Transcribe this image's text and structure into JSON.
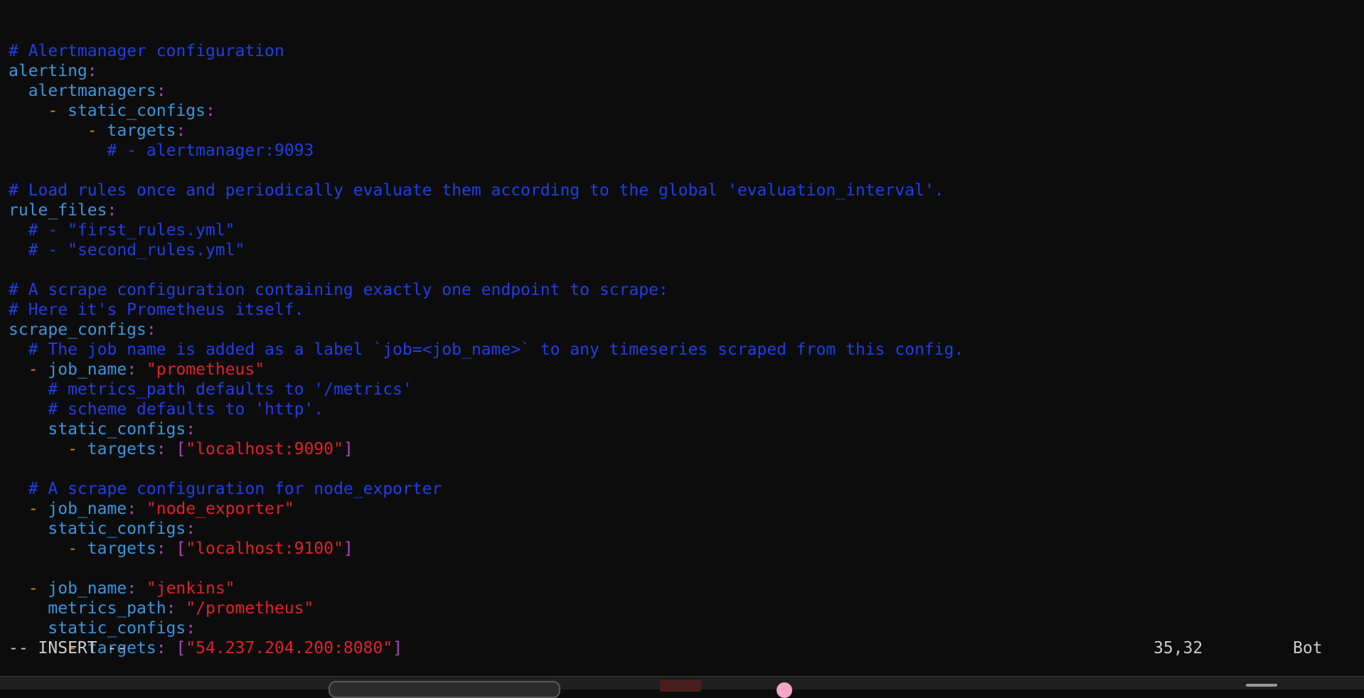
{
  "editor": {
    "lines": [
      {
        "id": "blank-top",
        "segments": []
      },
      {
        "id": "comment-alertmanager",
        "segments": [
          {
            "t": "# Alertmanager configuration",
            "c": "c"
          }
        ]
      },
      {
        "id": "key-alerting",
        "segments": [
          {
            "t": "alerting",
            "c": "k"
          },
          {
            "t": ":",
            "c": "p"
          }
        ]
      },
      {
        "id": "key-alertmanagers",
        "segments": [
          {
            "t": "  "
          },
          {
            "t": "alertmanagers",
            "c": "k"
          },
          {
            "t": ":",
            "c": "p"
          }
        ]
      },
      {
        "id": "key-static-configs-1",
        "segments": [
          {
            "t": "    "
          },
          {
            "t": "- ",
            "c": "d"
          },
          {
            "t": "static_configs",
            "c": "k"
          },
          {
            "t": ":",
            "c": "p"
          }
        ]
      },
      {
        "id": "key-targets-1",
        "segments": [
          {
            "t": "        "
          },
          {
            "t": "- ",
            "c": "d"
          },
          {
            "t": "targets",
            "c": "k"
          },
          {
            "t": ":",
            "c": "p"
          }
        ]
      },
      {
        "id": "comment-alertmanager-target",
        "segments": [
          {
            "t": "          "
          },
          {
            "t": "# - alertmanager:9093",
            "c": "c"
          }
        ]
      },
      {
        "id": "blank-1",
        "segments": []
      },
      {
        "id": "comment-load-rules",
        "segments": [
          {
            "t": "# Load rules once and periodically evaluate them according to the global 'evaluation_interval'.",
            "c": "c"
          }
        ]
      },
      {
        "id": "key-rule-files",
        "segments": [
          {
            "t": "rule_files",
            "c": "k"
          },
          {
            "t": ":",
            "c": "p"
          }
        ]
      },
      {
        "id": "comment-first-rules",
        "segments": [
          {
            "t": "  "
          },
          {
            "t": "# - \"first_rules.yml\"",
            "c": "c"
          }
        ]
      },
      {
        "id": "comment-second-rules",
        "segments": [
          {
            "t": "  "
          },
          {
            "t": "# - \"second_rules.yml\"",
            "c": "c"
          }
        ]
      },
      {
        "id": "blank-2",
        "segments": []
      },
      {
        "id": "comment-scrape-config",
        "segments": [
          {
            "t": "# A scrape configuration containing exactly one endpoint to scrape:",
            "c": "c"
          }
        ]
      },
      {
        "id": "comment-prometheus-itself",
        "segments": [
          {
            "t": "# Here it's Prometheus itself.",
            "c": "c"
          }
        ]
      },
      {
        "id": "key-scrape-configs",
        "segments": [
          {
            "t": "scrape_configs",
            "c": "k"
          },
          {
            "t": ":",
            "c": "p"
          }
        ]
      },
      {
        "id": "comment-job-name",
        "segments": [
          {
            "t": "  "
          },
          {
            "t": "# The job name is added as a label `job=<job_name>` to any timeseries scraped from this config.",
            "c": "c"
          }
        ]
      },
      {
        "id": "job-prometheus",
        "segments": [
          {
            "t": "  "
          },
          {
            "t": "- ",
            "c": "d"
          },
          {
            "t": "job_name",
            "c": "k"
          },
          {
            "t": ": ",
            "c": "p"
          },
          {
            "t": "\"prometheus\"",
            "c": "s"
          }
        ]
      },
      {
        "id": "comment-metrics-path",
        "segments": [
          {
            "t": "    "
          },
          {
            "t": "# metrics_path defaults to '/metrics'",
            "c": "c"
          }
        ]
      },
      {
        "id": "comment-scheme",
        "segments": [
          {
            "t": "    "
          },
          {
            "t": "# scheme defaults to 'http'.",
            "c": "c"
          }
        ]
      },
      {
        "id": "key-static-configs-2",
        "segments": [
          {
            "t": "    "
          },
          {
            "t": "static_configs",
            "c": "k"
          },
          {
            "t": ":",
            "c": "p"
          }
        ]
      },
      {
        "id": "targets-prometheus",
        "segments": [
          {
            "t": "      "
          },
          {
            "t": "- ",
            "c": "d"
          },
          {
            "t": "targets",
            "c": "k"
          },
          {
            "t": ": ",
            "c": "p"
          },
          {
            "t": "[",
            "c": "b"
          },
          {
            "t": "\"localhost:9090\"",
            "c": "s"
          },
          {
            "t": "]",
            "c": "b"
          }
        ]
      },
      {
        "id": "blank-3",
        "segments": []
      },
      {
        "id": "comment-node-exporter",
        "segments": [
          {
            "t": "  "
          },
          {
            "t": "# A scrape configuration for node_exporter",
            "c": "c"
          }
        ]
      },
      {
        "id": "job-node-exporter",
        "segments": [
          {
            "t": "  "
          },
          {
            "t": "- ",
            "c": "d"
          },
          {
            "t": "job_name",
            "c": "k"
          },
          {
            "t": ": ",
            "c": "p"
          },
          {
            "t": "\"node_exporter\"",
            "c": "s"
          }
        ]
      },
      {
        "id": "key-static-configs-3",
        "segments": [
          {
            "t": "    "
          },
          {
            "t": "static_configs",
            "c": "k"
          },
          {
            "t": ":",
            "c": "p"
          }
        ]
      },
      {
        "id": "targets-node-exporter",
        "segments": [
          {
            "t": "      "
          },
          {
            "t": "- ",
            "c": "d"
          },
          {
            "t": "targets",
            "c": "k"
          },
          {
            "t": ": ",
            "c": "p"
          },
          {
            "t": "[",
            "c": "b"
          },
          {
            "t": "\"localhost:9100\"",
            "c": "s"
          },
          {
            "t": "]",
            "c": "b"
          }
        ]
      },
      {
        "id": "blank-4",
        "segments": []
      },
      {
        "id": "job-jenkins",
        "segments": [
          {
            "t": "  "
          },
          {
            "t": "- ",
            "c": "d"
          },
          {
            "t": "job_name",
            "c": "k"
          },
          {
            "t": ": ",
            "c": "p"
          },
          {
            "t": "\"jenkins\"",
            "c": "s"
          }
        ]
      },
      {
        "id": "key-metrics-path",
        "segments": [
          {
            "t": "    "
          },
          {
            "t": "metrics_path",
            "c": "k"
          },
          {
            "t": ": ",
            "c": "p"
          },
          {
            "t": "\"/prometheus\"",
            "c": "s"
          }
        ]
      },
      {
        "id": "key-static-configs-4",
        "segments": [
          {
            "t": "    "
          },
          {
            "t": "static_configs",
            "c": "k"
          },
          {
            "t": ":",
            "c": "p"
          }
        ]
      },
      {
        "id": "targets-jenkins",
        "segments": [
          {
            "t": "      "
          },
          {
            "t": "- ",
            "c": "d"
          },
          {
            "t": "targets",
            "c": "k"
          },
          {
            "t": ": ",
            "c": "p"
          },
          {
            "t": "[",
            "c": "b"
          },
          {
            "t": "\"54.237.204.200:8080\"",
            "c": "s"
          },
          {
            "t": "]",
            "c": "b"
          }
        ]
      }
    ]
  },
  "statusline": {
    "mode": "-- INSERT --",
    "position": "35,32",
    "scroll": "Bot"
  },
  "colors": {
    "background": "#0c0c0c",
    "comment": "#1f3fe6",
    "key": "#3a96dd",
    "punctuation": "#b146c2",
    "dash": "#d58a1f",
    "string": "#e0212c"
  },
  "taskbar": {
    "icons": [
      "search-icon",
      "app-icon",
      "avatar-icon",
      "tray-icon"
    ]
  }
}
